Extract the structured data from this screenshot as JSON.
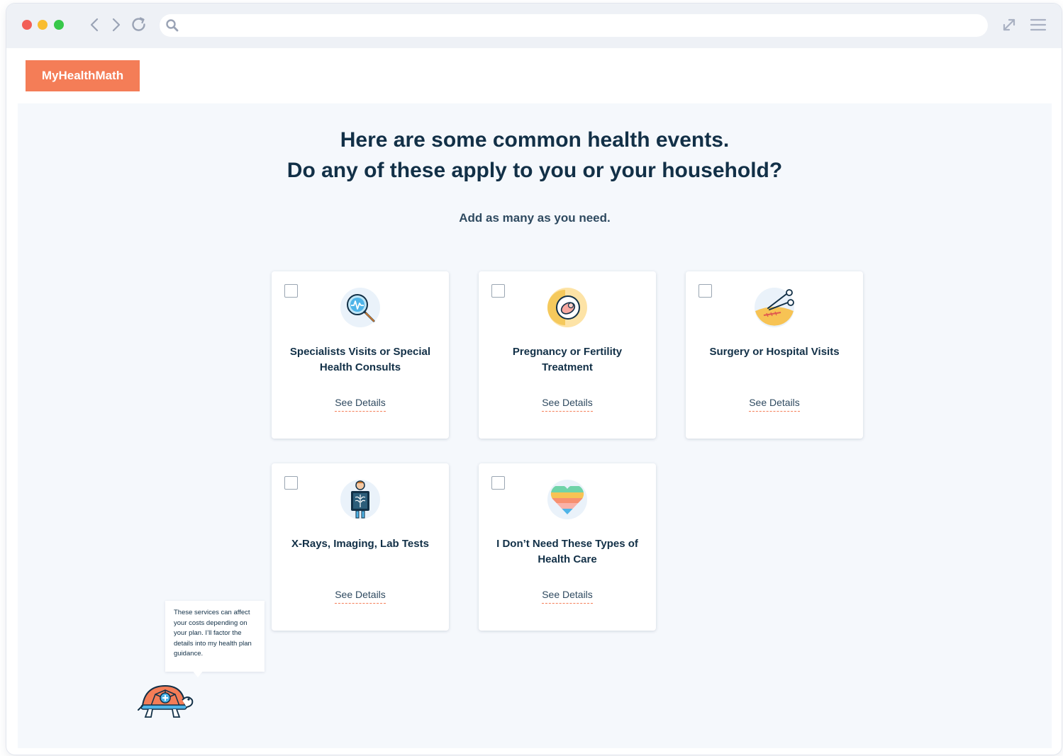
{
  "browser": {
    "url_value": "",
    "icons": [
      "chevron-left-icon",
      "chevron-right-icon",
      "reload-icon",
      "search-icon",
      "expand-icon",
      "menu-icon"
    ]
  },
  "brand": {
    "logo_text": "MyHealthMath",
    "accent_color": "#f47d57",
    "text_color": "#123047",
    "background_color": "#f5f8fc"
  },
  "main": {
    "heading_line1": "Here are some common health events.",
    "heading_line2": "Do any of these apply to you or your household?",
    "subheading": "Add as many as you need."
  },
  "cards": [
    {
      "title": "Specialists Visits or Special Health Consults",
      "link": "See Details",
      "checked": false,
      "icon": "magnifier-heartbeat-icon"
    },
    {
      "title": "Pregnancy or Fertility Treatment",
      "link": "See Details",
      "checked": false,
      "icon": "pregnancy-icon"
    },
    {
      "title": "Surgery or Hospital Visits",
      "link": "See Details",
      "checked": false,
      "icon": "surgery-scissors-icon"
    },
    {
      "title": "X-Rays, Imaging, Lab Tests",
      "link": "See Details",
      "checked": false,
      "icon": "xray-icon"
    },
    {
      "title": "I Don’t Need These Types of Health Care",
      "link": "See Details",
      "checked": false,
      "icon": "rainbow-heart-icon"
    }
  ],
  "helper": {
    "message": "These services can affect your costs depending on your plan. I’ll factor the details into my health plan guidance.",
    "mascot": "turtle-icon"
  }
}
